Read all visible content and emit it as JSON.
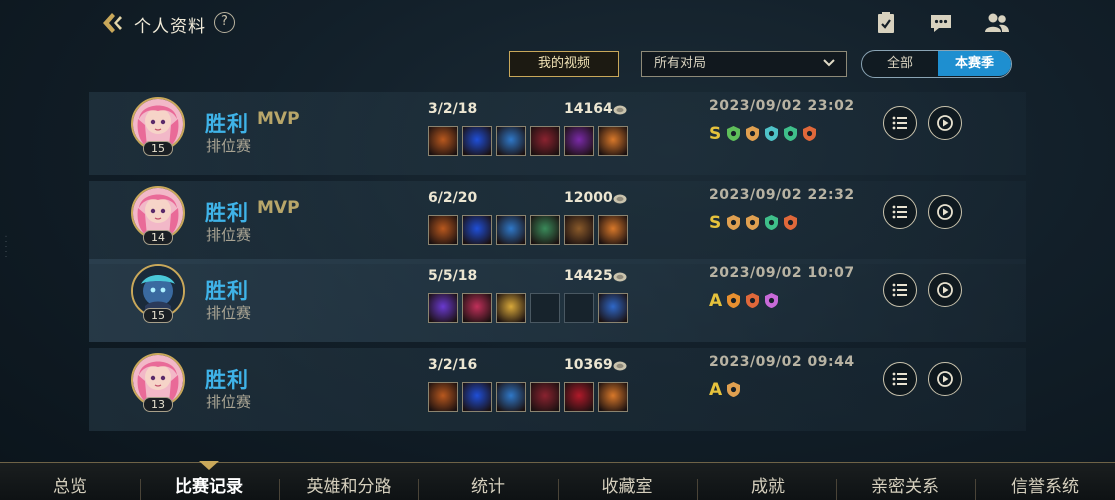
{
  "header": {
    "title": "个人资料",
    "help": "?"
  },
  "controls": {
    "my_video": "我的视频",
    "filter_value": "所有对局",
    "toggle": {
      "all": "全部",
      "season": "本赛季",
      "selected": "本赛季"
    }
  },
  "matches": [
    {
      "result": "胜利",
      "mvp": "MVP",
      "mode": "排位赛",
      "level": "15",
      "kda": "3/2/18",
      "score": "14164",
      "date": "2023/09/02 23:02",
      "grade": "S",
      "avatar_theme": "pink",
      "items": [
        "#b8581e",
        "#1f4fd8",
        "#2f78c8",
        "#8a2330",
        "#7a2aa8",
        "#d8782a"
      ],
      "badges": [
        "#5fbf5a",
        "#e0a050",
        "#4fc3c8",
        "#3fbf8a",
        "#e0683a"
      ]
    },
    {
      "result": "胜利",
      "mvp": "MVP",
      "mode": "排位赛",
      "level": "14",
      "kda": "6/2/20",
      "score": "12000",
      "date": "2023/09/02 22:32",
      "grade": "S",
      "avatar_theme": "pink",
      "items": [
        "#b8581e",
        "#1f4fd8",
        "#2f78c8",
        "#3a8a5a",
        "#8a5a2a",
        "#d8782a"
      ],
      "badges": [
        "#e0a050",
        "#e0a050",
        "#3fbf8a",
        "#e0683a"
      ]
    },
    {
      "result": "胜利",
      "mvp": "",
      "mode": "排位赛",
      "level": "15",
      "kda": "5/5/18",
      "score": "14425",
      "date": "2023/09/02 10:07",
      "grade": "A",
      "avatar_theme": "dark",
      "items": [
        "#6a3ad0",
        "#c0305a",
        "#d8a83a",
        "",
        "",
        "#2f68c8"
      ],
      "badges": [
        "#e89030",
        "#e0683a",
        "#c86ad8"
      ]
    },
    {
      "result": "胜利",
      "mvp": "",
      "mode": "排位赛",
      "level": "13",
      "kda": "3/2/16",
      "score": "10369",
      "date": "2023/09/02 09:44",
      "grade": "A",
      "avatar_theme": "pink",
      "items": [
        "#b8581e",
        "#1f4fd8",
        "#2f78c8",
        "#8a2330",
        "#b01a2a",
        "#d8782a"
      ],
      "badges": [
        "#e0a050"
      ]
    }
  ],
  "bottom_nav": {
    "tabs": [
      "总览",
      "比赛记录",
      "英雄和分路",
      "统计",
      "收藏室",
      "成就",
      "亲密关系",
      "信誉系统"
    ],
    "active": "比赛记录"
  },
  "colors": {
    "win": "#3fb3e8",
    "accent_gold": "#c9a85a",
    "toggle_active": "#1e8fd0",
    "grade": "#e6c23c"
  }
}
